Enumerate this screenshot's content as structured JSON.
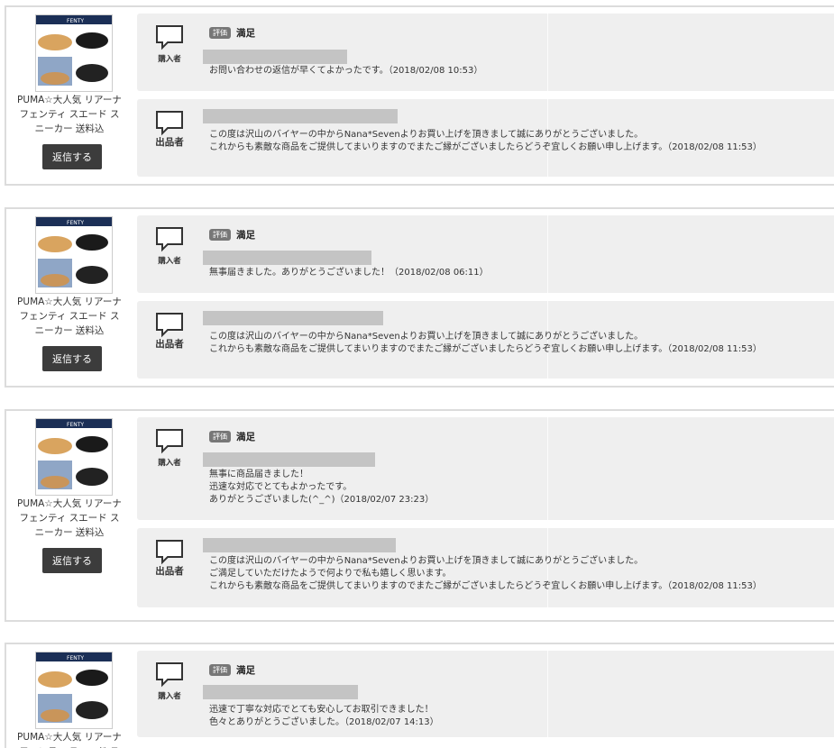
{
  "product": {
    "title": "PUMA☆大人気 リアーナ フェンティ スエード スニーカー 送料込",
    "reply_label": "返信する",
    "image_brand": "FENTY"
  },
  "labels": {
    "buyer": "購入者",
    "seller": "出品者",
    "review_badge": "評価"
  },
  "reviews": [
    {
      "rating": "満足",
      "buyer_lines": [
        "お問い合わせの返信が早くてよかったです。（2018/02/08 10:53）"
      ],
      "seller_lines": [
        "この度は沢山のバイヤーの中からNana*Sevenよりお買い上げを頂きまして誠にありがとうございました。",
        "これからも素敵な商品をご提供してまいりますのでまたご縁がございましたらどうぞ宜しくお願い申し上げます。（2018/02/08 11:53）"
      ]
    },
    {
      "rating": "満足",
      "buyer_lines": [
        "無事届きました。ありがとうございました！（2018/02/08 06:11）"
      ],
      "seller_lines": [
        "この度は沢山のバイヤーの中からNana*Sevenよりお買い上げを頂きまして誠にありがとうございました。",
        "これからも素敵な商品をご提供してまいりますのでまたご縁がございましたらどうぞ宜しくお願い申し上げます。（2018/02/08 11:53）"
      ]
    },
    {
      "rating": "満足",
      "buyer_lines": [
        "無事に商品届きました！",
        "迅速な対応でとてもよかったです。",
        "ありがとうございました(^_^)（2018/02/07 23:23）"
      ],
      "seller_lines": [
        "この度は沢山のバイヤーの中からNana*Sevenよりお買い上げを頂きまして誠にありがとうございました。",
        "ご満足していただけたようで何よりで私も嬉しく思います。",
        "これからも素敵な商品をご提供してまいりますのでまたご縁がございましたらどうぞ宜しくお願い申し上げます。（2018/02/08 11:53）"
      ]
    },
    {
      "rating": "満足",
      "buyer_lines": [
        "迅速で丁寧な対応でとても安心してお取引できました！",
        "色々とありがとうございました。（2018/02/07 14:13）"
      ]
    }
  ]
}
